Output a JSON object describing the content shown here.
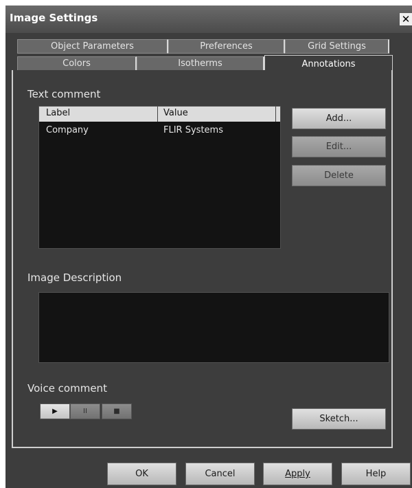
{
  "window": {
    "title": "Image Settings",
    "close_glyph": "✕"
  },
  "tabs": {
    "row1": [
      "Object Parameters",
      "Preferences",
      "Grid Settings"
    ],
    "row2": [
      "Colors",
      "Isotherms",
      "Annotations"
    ],
    "active": "Annotations"
  },
  "text_comment": {
    "label": "Text comment",
    "columns": [
      "Label",
      "Value"
    ],
    "rows": [
      {
        "label": "Company",
        "value": "FLIR Systems"
      }
    ]
  },
  "buttons": {
    "add": "Add...",
    "edit": "Edit...",
    "delete": "Delete",
    "sketch": "Sketch..."
  },
  "image_description": {
    "label": "Image Description",
    "value": ""
  },
  "voice_comment": {
    "label": "Voice comment",
    "play": "▶",
    "pause": "II",
    "stop": "■"
  },
  "footer": {
    "ok": "OK",
    "cancel": "Cancel",
    "apply": "Apply",
    "help": "Help"
  },
  "icons": [
    "close-icon",
    "play-icon",
    "pause-icon",
    "stop-icon"
  ]
}
